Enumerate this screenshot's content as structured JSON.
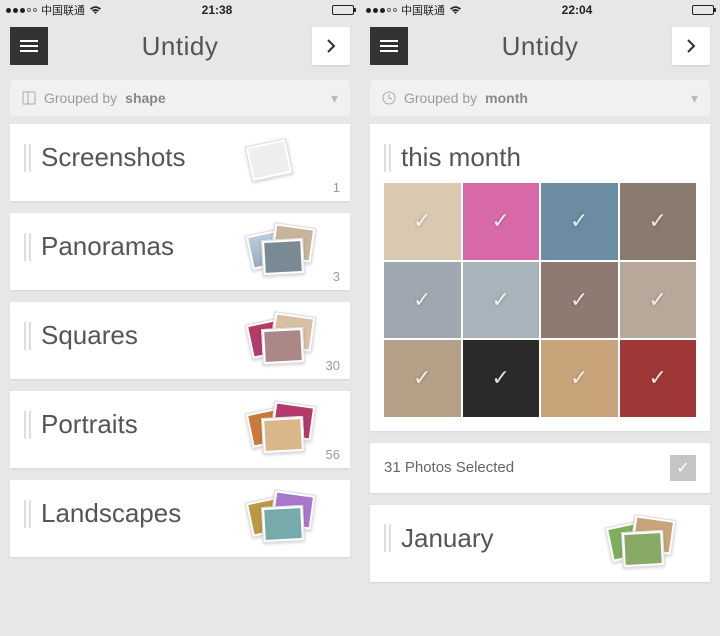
{
  "left": {
    "status": {
      "carrier": "中国联通",
      "time": "21:38"
    },
    "app_title": "Untidy",
    "filter": {
      "prefix": "Grouped by",
      "value": "shape"
    },
    "groups": [
      {
        "title": "Screenshots",
        "count": "1"
      },
      {
        "title": "Panoramas",
        "count": "3"
      },
      {
        "title": "Squares",
        "count": "30"
      },
      {
        "title": "Portraits",
        "count": "56"
      },
      {
        "title": "Landscapes",
        "count": ""
      }
    ]
  },
  "right": {
    "status": {
      "carrier": "中国联通",
      "time": "22:04"
    },
    "app_title": "Untidy",
    "filter": {
      "prefix": "Grouped by",
      "value": "month"
    },
    "group_title": "this month",
    "selection_text": "31 Photos Selected",
    "next_group": "January"
  }
}
